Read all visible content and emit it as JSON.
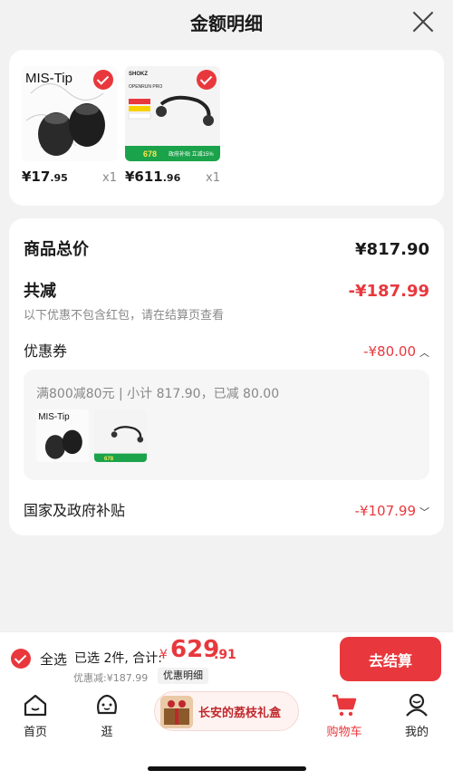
{
  "header": {
    "title": "金额明细"
  },
  "products": [
    {
      "brand": "MIS-Tip",
      "price_int": "¥17",
      "price_dec": ".95",
      "qty": "x1"
    },
    {
      "brand": "SHOKZ",
      "model": "OPENRUN PRO",
      "price_int": "¥611",
      "price_dec": ".96",
      "qty": "x1",
      "promo_price": "678",
      "promo_text": "政府补贴 立减15%"
    }
  ],
  "summary": {
    "total_label": "商品总价",
    "total_value": "¥817.90",
    "reduce_label": "共减",
    "reduce_value": "-¥187.99",
    "reduce_note": "以下优惠不包含红包，请在结算页查看",
    "coupon_label": "优惠券",
    "coupon_value": "-¥80.00",
    "coupon_detail": "满800减80元 | 小计 817.90，已减 80.00",
    "subsidy_label": "国家及政府补贴",
    "subsidy_value": "-¥107.99"
  },
  "bottom": {
    "select_all": "全选",
    "selected_text": "已选 2件, 合计:",
    "total_currency": "¥",
    "total_int": "629",
    "total_dec": ".91",
    "saved": "优惠减:¥187.99",
    "detail_chip": "优惠明细",
    "checkout": "去结算"
  },
  "tabbar": {
    "home": "首页",
    "browse": "逛",
    "promo": "长安的荔枝礼盒",
    "cart": "购物车",
    "mine": "我的"
  },
  "colors": {
    "accent": "#e8383d"
  }
}
